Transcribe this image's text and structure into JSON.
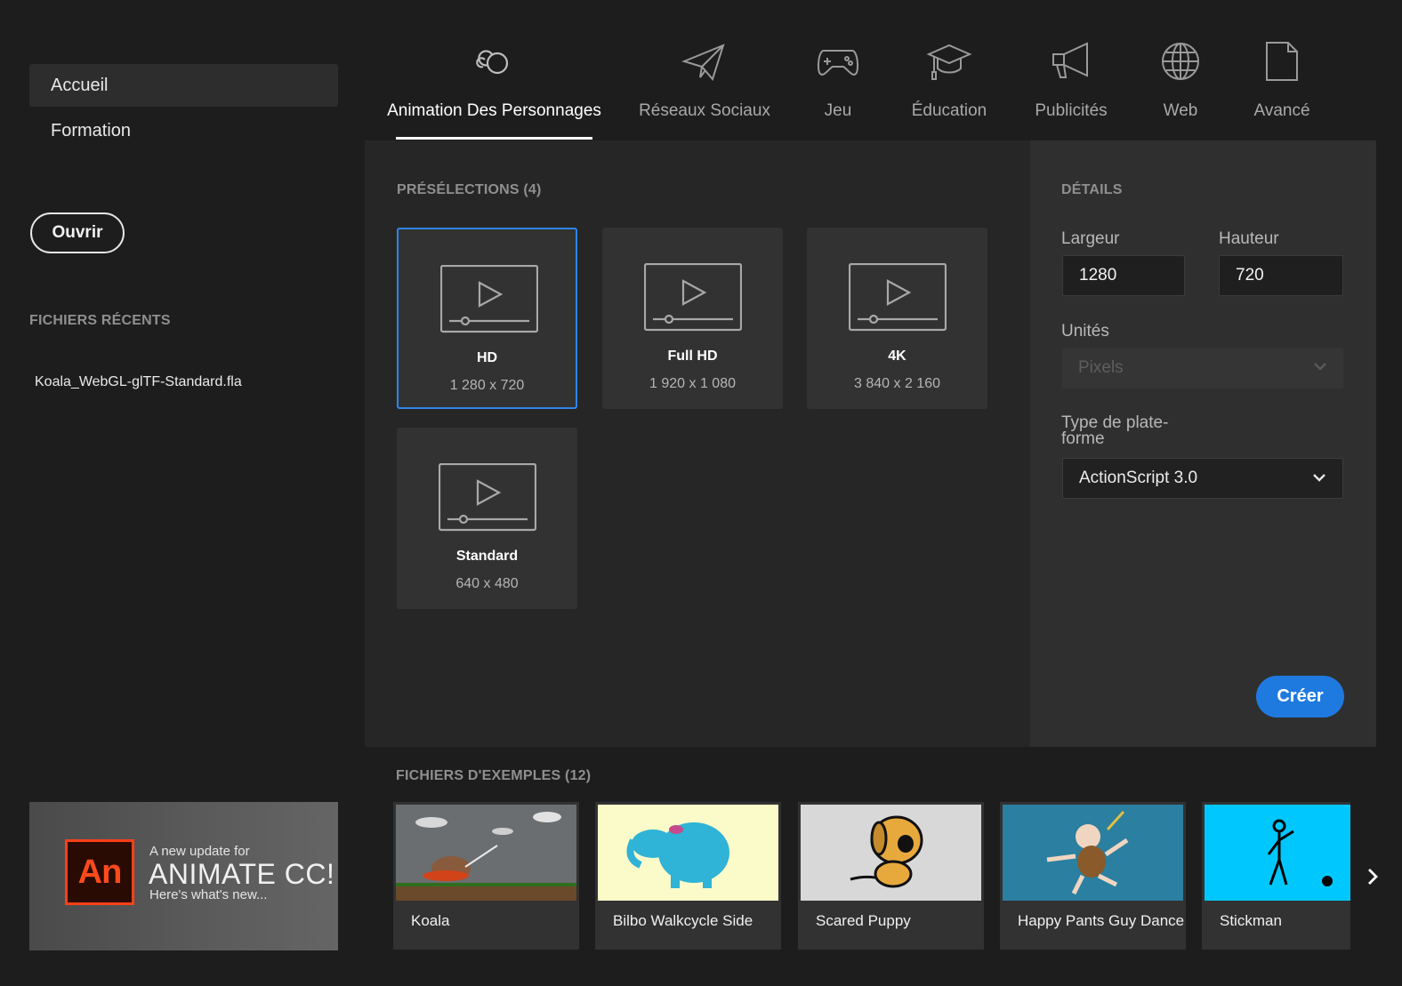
{
  "sidebar": {
    "nav": [
      {
        "label": "Accueil"
      },
      {
        "label": "Formation"
      }
    ],
    "open_button": "Ouvrir",
    "recent_label": "FICHIERS RÉCENTS",
    "recent_files": [
      "Koala_WebGL-glTF-Standard.fla"
    ],
    "banner": {
      "logo_text": "An",
      "line1": "A new update for",
      "line2": "ANIMATE CC!",
      "line3": "Here's what's new..."
    }
  },
  "tabs": [
    {
      "label": "Animation Des Personnages",
      "icon": "character-animation-icon"
    },
    {
      "label": "Réseaux Sociaux",
      "icon": "paper-plane-icon"
    },
    {
      "label": "Jeu",
      "icon": "gamepad-icon"
    },
    {
      "label": "Éducation",
      "icon": "graduation-cap-icon"
    },
    {
      "label": "Publicités",
      "icon": "megaphone-icon"
    },
    {
      "label": "Web",
      "icon": "globe-icon"
    },
    {
      "label": "Avancé",
      "icon": "document-icon"
    }
  ],
  "presets": {
    "label": "PRÉSÉLECTIONS (4)",
    "items": [
      {
        "name": "HD",
        "size": "1 280 x 720"
      },
      {
        "name": "Full HD",
        "size": "1 920 x 1 080"
      },
      {
        "name": "4K",
        "size": "3 840 x 2 160"
      },
      {
        "name": "Standard",
        "size": "640 x 480"
      }
    ]
  },
  "details": {
    "label": "DÉTAILS",
    "width_label": "Largeur",
    "width_value": "1280",
    "height_label": "Hauteur",
    "height_value": "720",
    "units_label": "Unités",
    "units_value": "Pixels",
    "platform_label_line1": "Type de plate-",
    "platform_label_line2": "forme",
    "platform_value": "ActionScript 3.0",
    "create_button": "Créer"
  },
  "samples": {
    "label": "FICHIERS D'EXEMPLES (12)",
    "items": [
      {
        "title": "Koala"
      },
      {
        "title": "Bilbo Walkcycle Side"
      },
      {
        "title": "Scared Puppy"
      },
      {
        "title": "Happy Pants Guy Dance"
      },
      {
        "title": "Stickman"
      }
    ]
  },
  "colors": {
    "accent": "#1f7ae0",
    "selected_border": "#2e85eb",
    "background": "#1d1d1d"
  }
}
